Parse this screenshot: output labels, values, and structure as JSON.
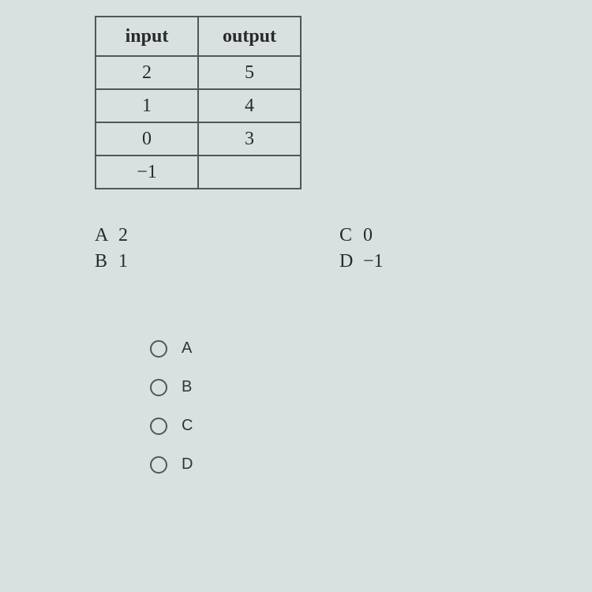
{
  "table": {
    "headers": {
      "in": "input",
      "out": "output"
    },
    "rows": [
      {
        "in": "2",
        "out": "5"
      },
      {
        "in": "1",
        "out": "4"
      },
      {
        "in": "0",
        "out": "3"
      },
      {
        "in": "−1",
        "out": ""
      }
    ]
  },
  "choices": {
    "a": {
      "letter": "A",
      "value": "2"
    },
    "b": {
      "letter": "B",
      "value": "1"
    },
    "c": {
      "letter": "C",
      "value": "0"
    },
    "d": {
      "letter": "D",
      "value": "−1"
    }
  },
  "radios": {
    "a": "A",
    "b": "B",
    "c": "C",
    "d": "D"
  }
}
